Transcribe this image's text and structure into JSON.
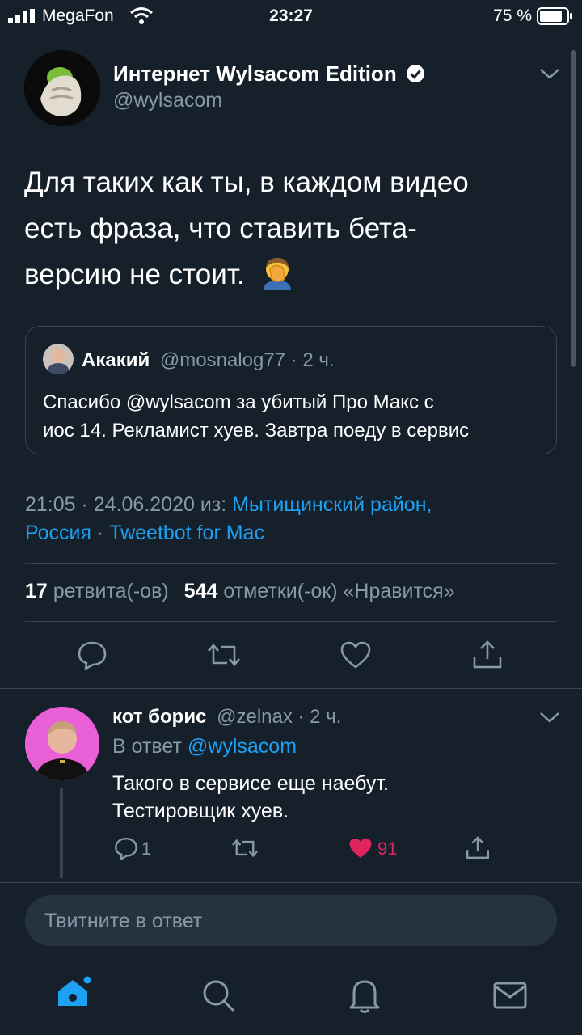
{
  "status": {
    "carrier": "MegaFon",
    "time": "23:27",
    "battery": "75 %"
  },
  "tweet": {
    "name": "Интернет Wylsacom Edition",
    "handle": "@wylsacom",
    "text_lines": [
      "Для таких как ты, в каждом видео",
      "есть фраза, что ставить бета-",
      "версию не стоит."
    ],
    "quote": {
      "name": "Акакий",
      "meta": "@mosnalog77 · 2 ч.",
      "lines": [
        "Спасибо @wylsacom за убитый Про Макс с",
        "иос 14. Рекламист хуев. Завтра поеду в сервис"
      ]
    },
    "meta_time": "21:05 · 24.06.2020 из: ",
    "meta_location": "Мытищинский район,",
    "meta_location2": "Россия",
    "meta_sep": " · ",
    "meta_client": "Tweetbot for Mac",
    "retweets": "17",
    "retweets_label": "ретвита(-ов)",
    "likes": "544",
    "likes_label": "отметки(-ок) «Нравится»"
  },
  "reply": {
    "name": "кот борис",
    "meta": "@zelnax · 2 ч.",
    "reply_to_label": "В ответ",
    "reply_to": "@wylsacom",
    "lines": [
      "Такого в сервисе еще наебут.",
      "Тестировщик хуев."
    ],
    "reply_count": "1",
    "like_count": "91"
  },
  "compose": {
    "placeholder": "Твитните в ответ"
  },
  "colors": {
    "bg": "#15202b",
    "accent": "#1da1f2",
    "muted": "#8899a6",
    "like": "#e0245e"
  },
  "icons": [
    "home-icon",
    "search-icon",
    "bell-icon",
    "mail-icon",
    "reply-icon",
    "retweet-icon",
    "like-icon",
    "share-icon",
    "chevron-down-icon",
    "verified-icon",
    "facepalm-emoji"
  ]
}
